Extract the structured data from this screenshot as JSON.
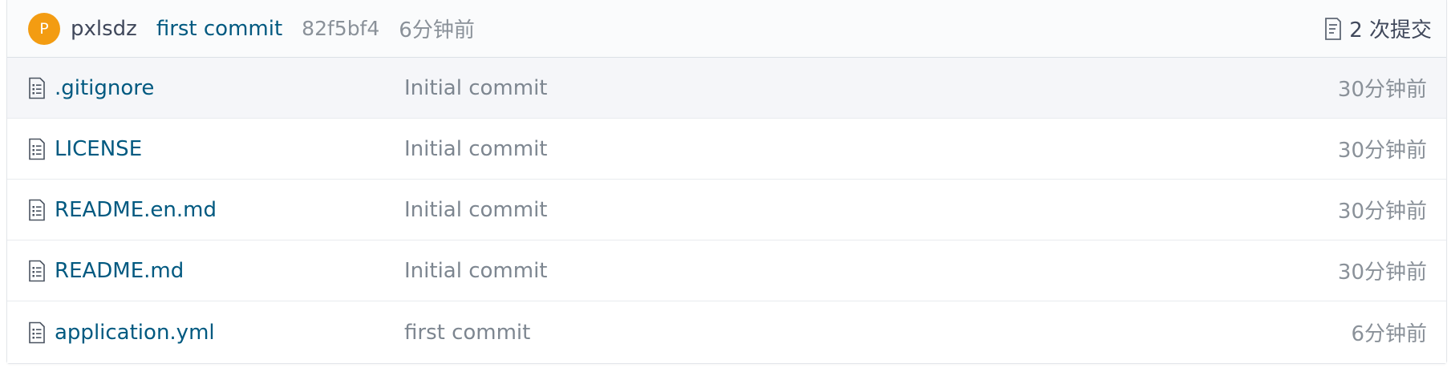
{
  "latest_commit": {
    "avatar_letter": "P",
    "avatar_color": "#f39c12",
    "author": "pxlsdz",
    "message": "first commit",
    "sha": "82f5bf4",
    "time": "6分钟前",
    "commits_count_label": "2 次提交",
    "commits_icon": "history-icon"
  },
  "files": [
    {
      "icon": "file-icon",
      "name": ".gitignore",
      "commit": "Initial commit",
      "time": "30分钟前"
    },
    {
      "icon": "file-icon",
      "name": "LICENSE",
      "commit": "Initial commit",
      "time": "30分钟前"
    },
    {
      "icon": "file-icon",
      "name": "README.en.md",
      "commit": "Initial commit",
      "time": "30分钟前"
    },
    {
      "icon": "file-icon",
      "name": "README.md",
      "commit": "Initial commit",
      "time": "30分钟前"
    },
    {
      "icon": "file-icon",
      "name": "application.yml",
      "commit": "first commit",
      "time": "6分钟前"
    }
  ],
  "colors": {
    "link": "#005980",
    "muted": "#8a9199",
    "text": "#40485b",
    "header_bg": "#fafbfc",
    "hover_row_bg": "#f5f6f9"
  }
}
